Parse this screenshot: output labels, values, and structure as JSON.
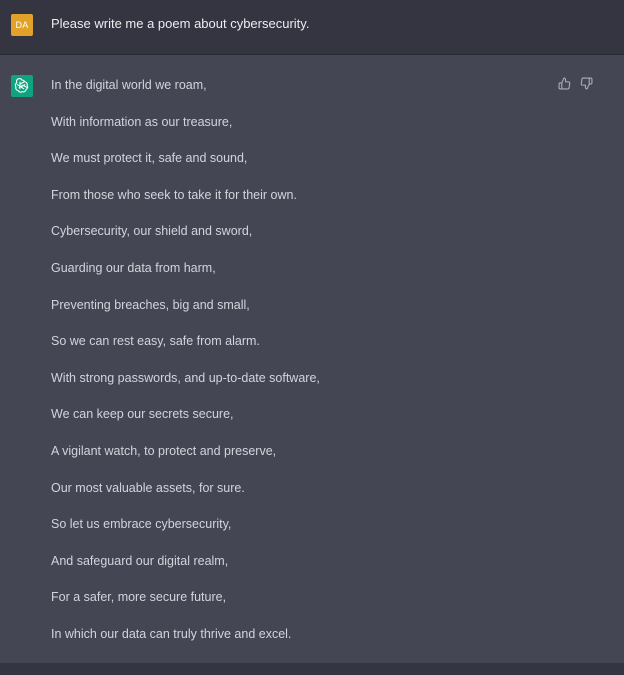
{
  "user_message": {
    "avatar_initials": "DA",
    "avatar_color": "#e2a22a",
    "text": "Please write me a poem about cybersecurity."
  },
  "assistant_message": {
    "avatar_icon": "openai-logo-icon",
    "avatar_color": "#10a37f",
    "lines": [
      "In the digital world we roam,",
      "With information as our treasure,",
      "We must protect it, safe and sound,",
      "From those who seek to take it for their own.",
      "Cybersecurity, our shield and sword,",
      "Guarding our data from harm,",
      "Preventing breaches, big and small,",
      "So we can rest easy, safe from alarm.",
      "With strong passwords, and up-to-date software,",
      "We can keep our secrets secure,",
      "A vigilant watch, to protect and preserve,",
      "Our most valuable assets, for sure.",
      "So let us embrace cybersecurity,",
      "And safeguard our digital realm,",
      "For a safer, more secure future,",
      "In which our data can truly thrive and excel."
    ],
    "feedback": {
      "thumbs_up_icon": "thumbs-up-icon",
      "thumbs_down_icon": "thumbs-down-icon"
    }
  },
  "colors": {
    "user_row_bg": "#343541",
    "assistant_row_bg": "#444654",
    "text": "#d1d5db"
  }
}
